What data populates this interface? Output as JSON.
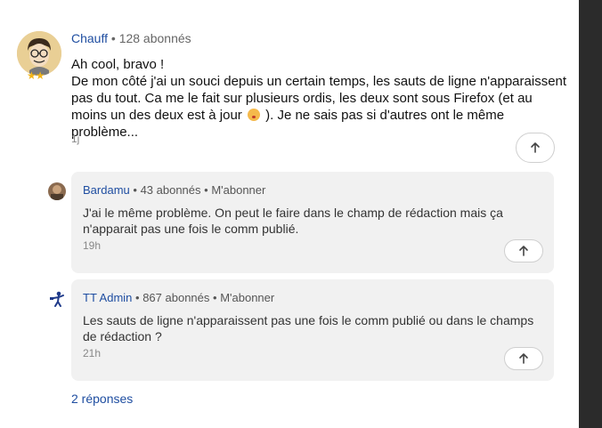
{
  "main_comment": {
    "author": "Chauff",
    "subscribers": "128 abonnés",
    "lines": [
      "Ah cool, bravo !",
      "De mon côté j'ai un souci depuis un certain temps, les sauts de ligne n'apparaissent pas du tout. Ca me le fait sur plusieurs ordis, les deux sont sous Firefox (et au moins un des deux est à jour",
      "). Je ne sais pas si d'autres ont le même problème..."
    ],
    "time": "1j",
    "emoji_icon": "surprised-face-icon",
    "badge_icon": "two-stars-icon"
  },
  "replies": [
    {
      "author": "Bardamu",
      "subscribers": "43 abonnés",
      "subscribe_label": "M'abonner",
      "text": "J'ai le même problème. On peut le faire dans le champ de rédaction mais ça n'apparait pas une fois le comm publié.",
      "time": "19h"
    },
    {
      "author": "TT Admin",
      "subscribers": "867 abonnés",
      "subscribe_label": "M'abonner",
      "text": "Les sauts de ligne n'apparaissent pas une fois le comm publié ou dans le champs de rédaction ?",
      "time": "21h"
    }
  ],
  "replies_link": "2 réponses",
  "separator": "•",
  "colors": {
    "author_link": "#1f4ea1",
    "card_bg": "#f1f1f1",
    "rail": "#2b2b2b"
  }
}
